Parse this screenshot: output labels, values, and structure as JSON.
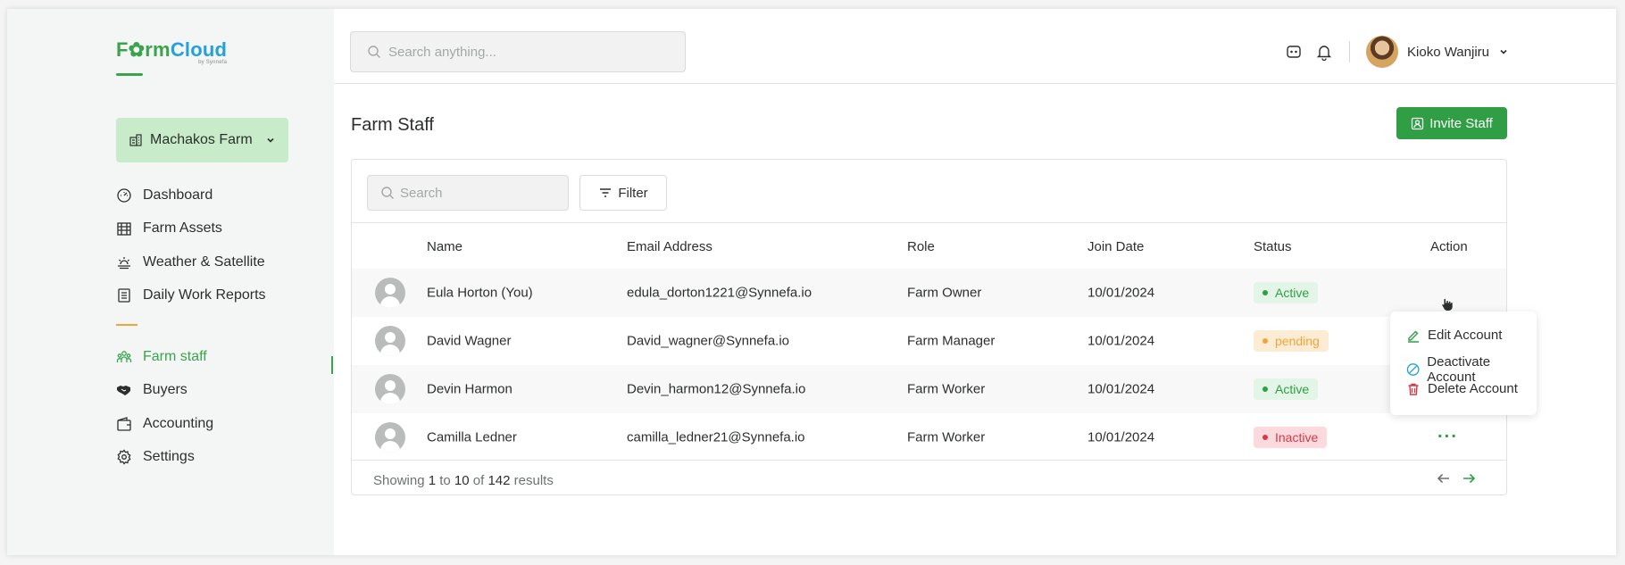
{
  "brand": {
    "name_part1": "F",
    "name_part2": "rm",
    "name_part3": "Cloud",
    "sub": "by Synnefa"
  },
  "farm_selector": {
    "label": "Machakos Farm",
    "icon": "building-icon"
  },
  "sidebar": {
    "items": [
      {
        "label": "Dashboard",
        "icon": "dashboard-icon"
      },
      {
        "label": "Farm Assets",
        "icon": "farm-assets-icon"
      },
      {
        "label": "Weather & Satellite",
        "icon": "weather-icon"
      },
      {
        "label": "Daily Work Reports",
        "icon": "reports-icon"
      }
    ],
    "items2": [
      {
        "label": "Farm staff",
        "icon": "staff-icon",
        "active": true
      },
      {
        "label": "Buyers",
        "icon": "handshake-icon"
      },
      {
        "label": "Accounting",
        "icon": "wallet-icon"
      },
      {
        "label": "Settings",
        "icon": "settings-icon"
      }
    ]
  },
  "topbar": {
    "search_placeholder": "Search anything...",
    "user_name": "Kioko Wanjiru"
  },
  "page": {
    "title": "Farm Staff",
    "invite_label": "Invite Staff"
  },
  "table": {
    "search_placeholder": "Search",
    "filter_label": "Filter",
    "headers": {
      "name": "Name",
      "email": "Email Address",
      "role": "Role",
      "join": "Join Date",
      "status": "Status",
      "action": "Action"
    },
    "rows": [
      {
        "name": "Eula Horton (You)",
        "email": "edula_dorton1221@Synnefa.io",
        "role": "Farm Owner",
        "join": "10/01/2024",
        "status": "Active"
      },
      {
        "name": "David Wagner",
        "email": "David_wagner@Synnefa.io",
        "role": "Farm Manager",
        "join": "10/01/2024",
        "status": "pending"
      },
      {
        "name": "Devin Harmon",
        "email": "Devin_harmon12@Synnefa.io",
        "role": "Farm Worker",
        "join": "10/01/2024",
        "status": "Active"
      },
      {
        "name": "Camilla Ledner",
        "email": "camilla_ledner21@Synnefa.io",
        "role": "Farm Worker",
        "join": "10/01/2024",
        "status": "Inactive"
      }
    ],
    "footer": {
      "showing": "Showing",
      "from": "1",
      "to_word": "to",
      "to": "10",
      "of_word": "of",
      "total": "142",
      "results": "results"
    },
    "action_dots": "···"
  },
  "action_menu": {
    "edit": "Edit Account",
    "deactivate": "Deactivate Account",
    "delete": "Delete Account"
  },
  "colors": {
    "brand_green": "#2f9e44",
    "brand_blue": "#23a1d8",
    "accent_orange": "#f0a53a",
    "danger": "#d33a4a"
  }
}
